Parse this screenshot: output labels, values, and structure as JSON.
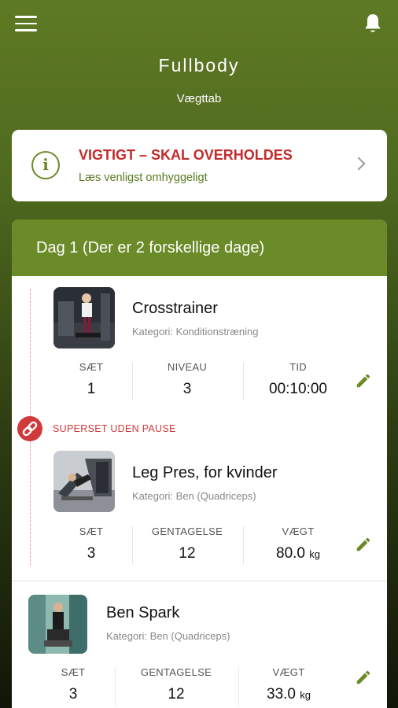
{
  "header": {
    "menu_icon": "hamburger-menu-icon",
    "bell_icon": "bell-icon",
    "title": "Fullbody",
    "subtitle": "Vægttab"
  },
  "notice": {
    "icon": "info-icon",
    "title": "VIGTIGT – SKAL OVERHOLDES",
    "subtitle": "Læs venligst omhyggeligt",
    "chevron": "chevron-right-icon",
    "title_color": "#c42a2a",
    "accent_color": "#6b8a28"
  },
  "day": {
    "header": "Dag 1 (Der er 2 forskellige dage)",
    "superset_label": "SUPERSET UDEN PAUSE",
    "superset_icon": "link-icon",
    "exercises": [
      {
        "name": "Crosstrainer",
        "category": "Kategori: Konditionstræning",
        "stats": [
          {
            "label": "SÆT",
            "value": "1"
          },
          {
            "label": "NIVEAU",
            "value": "3"
          },
          {
            "label": "TID",
            "value": "00:10:00"
          }
        ]
      },
      {
        "name": "Leg Pres, for kvinder",
        "category": "Kategori: Ben (Quadriceps)",
        "stats": [
          {
            "label": "SÆT",
            "value": "3"
          },
          {
            "label": "GENTAGELSE",
            "value": "12"
          },
          {
            "label": "VÆGT",
            "value": "80.0",
            "unit": "kg"
          }
        ]
      },
      {
        "name": "Ben Spark",
        "category": "Kategori: Ben (Quadriceps)",
        "stats": [
          {
            "label": "SÆT",
            "value": "3"
          },
          {
            "label": "GENTAGELSE",
            "value": "12"
          },
          {
            "label": "VÆGT",
            "value": "33.0",
            "unit": "kg"
          }
        ]
      }
    ]
  }
}
